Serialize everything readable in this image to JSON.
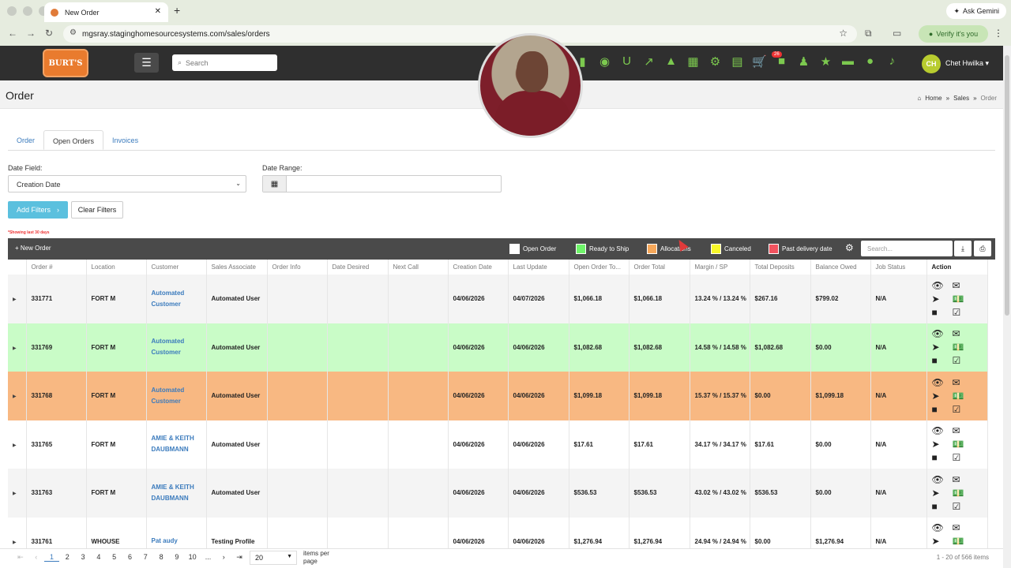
{
  "browser": {
    "tab_title": "New Order",
    "new_tab": "+",
    "ask_gemini": "Ask Gemini",
    "url": "mgsray.staginghomesourcesystems.com/sales/orders",
    "verify": "Verify it's you"
  },
  "app": {
    "logo_text": "BURT'S",
    "search_placeholder": "Search",
    "cart_badge": "26",
    "user_initials": "CH",
    "user_name": "Chet Hwilka ▾"
  },
  "page": {
    "title": "Order",
    "breadcrumb": [
      "Home",
      "»",
      "Sales",
      "»",
      "Order"
    ]
  },
  "tabs": [
    "Order",
    "Open Orders",
    "Invoices"
  ],
  "filters": {
    "date_field_label": "Date Field:",
    "date_field_value": "Creation Date",
    "date_range_label": "Date Range:",
    "add_filters": "Add Filters",
    "clear_filters": "Clear Filters",
    "showing": "*Showing last 30 days"
  },
  "toolbar": {
    "new_order": "+ New Order",
    "legend": [
      {
        "label": "Open Order",
        "color": "#ffffff"
      },
      {
        "label": "Ready to Ship",
        "color": "#6ff56a"
      },
      {
        "label": "Allocations",
        "color": "#f7a85a"
      },
      {
        "label": "Canceled",
        "color": "#f8f82a"
      },
      {
        "label": "Past delivery date",
        "color": "#f2535f"
      }
    ],
    "search_placeholder": "Search..."
  },
  "table": {
    "columns": [
      "",
      "Order #",
      "Location",
      "Customer",
      "Sales Associate",
      "Order Info",
      "Date Desired",
      "Next Call",
      "Creation Date",
      "Last Update",
      "Open Order To...",
      "Order Total",
      "Margin / SP",
      "Total Deposits",
      "Balance Owed",
      "Job Status",
      "Action"
    ],
    "rows": [
      {
        "order": "331771",
        "location": "FORT M",
        "customer": "Automated Customer",
        "associate": "Automated User",
        "created": "04/06/2026",
        "updated": "04/07/2026",
        "open_total": "$1,066.18",
        "total": "$1,066.18",
        "margin": "13.24 % / 13.24 %",
        "deposits": "$267.16",
        "balance": "$799.02",
        "status": "N/A",
        "style": "gray"
      },
      {
        "order": "331769",
        "location": "FORT M",
        "customer": "Automated Customer",
        "associate": "Automated User",
        "created": "04/06/2026",
        "updated": "04/06/2026",
        "open_total": "$1,082.68",
        "total": "$1,082.68",
        "margin": "14.58 % / 14.58 %",
        "deposits": "$1,082.68",
        "balance": "$0.00",
        "status": "N/A",
        "style": "green"
      },
      {
        "order": "331768",
        "location": "FORT M",
        "customer": "Automated Customer",
        "associate": "Automated User",
        "created": "04/06/2026",
        "updated": "04/06/2026",
        "open_total": "$1,099.18",
        "total": "$1,099.18",
        "margin": "15.37 % / 15.37 %",
        "deposits": "$0.00",
        "balance": "$1,099.18",
        "status": "N/A",
        "style": "orange"
      },
      {
        "order": "331765",
        "location": "FORT M",
        "customer": "AMIE & KEITH DAUBMANN",
        "associate": "Automated User",
        "created": "04/06/2026",
        "updated": "04/06/2026",
        "open_total": "$17.61",
        "total": "$17.61",
        "margin": "34.17 % / 34.17 %",
        "deposits": "$17.61",
        "balance": "$0.00",
        "status": "N/A",
        "style": "white"
      },
      {
        "order": "331763",
        "location": "FORT M",
        "customer": "AMIE & KEITH DAUBMANN",
        "associate": "Automated User",
        "created": "04/06/2026",
        "updated": "04/06/2026",
        "open_total": "$536.53",
        "total": "$536.53",
        "margin": "43.02 % / 43.02 %",
        "deposits": "$536.53",
        "balance": "$0.00",
        "status": "N/A",
        "style": "gray"
      },
      {
        "order": "331761",
        "location": "WHOUSE",
        "customer": "Pat audy",
        "associate": "Testing Profile",
        "created": "04/06/2026",
        "updated": "04/06/2026",
        "open_total": "$1,276.94",
        "total": "$1,276.94",
        "margin": "24.94 % / 24.94 %",
        "deposits": "$0.00",
        "balance": "$1,276.94",
        "status": "N/A",
        "style": "white"
      }
    ]
  },
  "pagination": {
    "pages": [
      "1",
      "2",
      "3",
      "4",
      "5",
      "6",
      "7",
      "8",
      "9",
      "10",
      "..."
    ],
    "per_page": "20",
    "per_page_label": "items per page",
    "count": "1 - 20 of 566 items"
  }
}
